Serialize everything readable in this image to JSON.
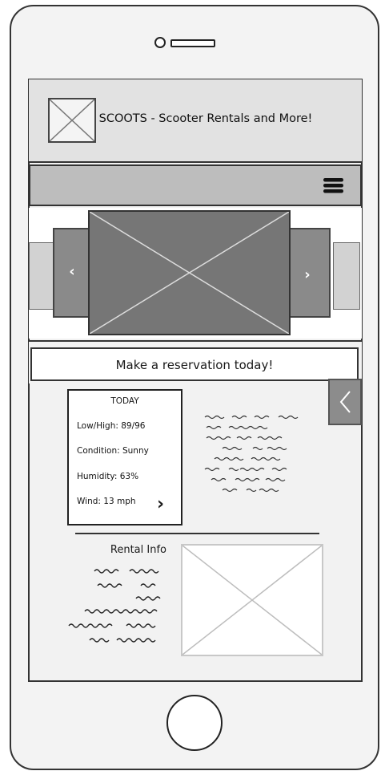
{
  "header": {
    "title": "SCOOTS - Scooter Rentals and More!"
  },
  "nav": {
    "menu_icon": "hamburger-icon"
  },
  "carousel": {
    "prev_label": "‹",
    "next_label": "›"
  },
  "reservation": {
    "label": "Make a reservation today!"
  },
  "weather": {
    "title": "TODAY",
    "low_high": "Low/High: 89/96",
    "condition": "Condition: Sunny",
    "humidity": "Humidity: 63%",
    "wind": "Wind: 13 mph",
    "next_label": "›"
  },
  "side_tab": {
    "label": "‹"
  },
  "rental": {
    "title": "Rental Info"
  }
}
